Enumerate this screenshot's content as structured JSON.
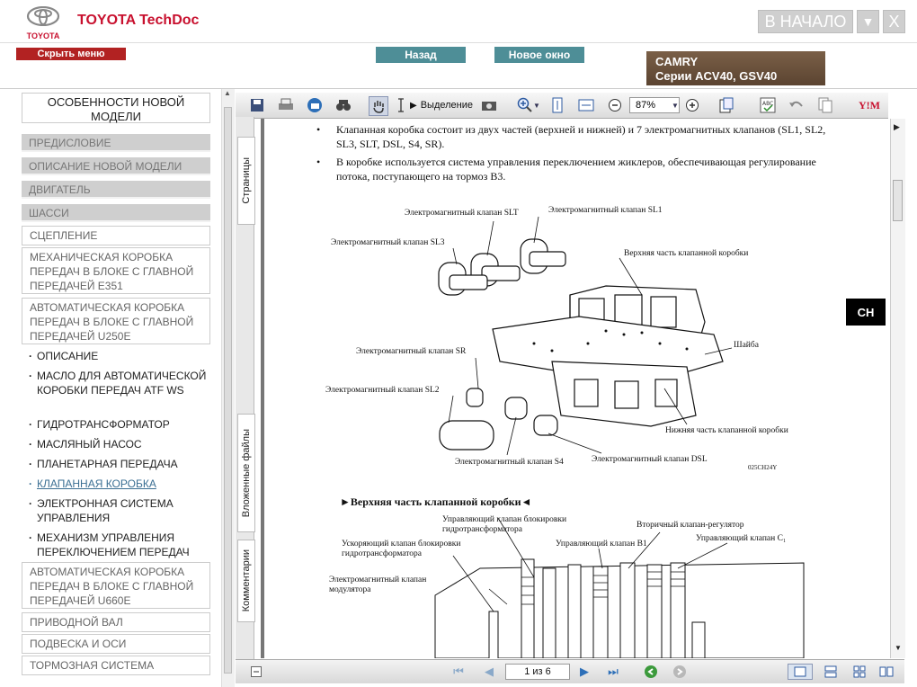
{
  "header": {
    "brand_title": "TOYOTA TechDoc",
    "logo_text": "TOYOTA",
    "home_button": "В НАЧАЛО",
    "menu_button": "▼",
    "close_button": "X"
  },
  "subbar": {
    "hide_menu": "Скрыть меню",
    "back": "Назад",
    "new_window": "Новое окно",
    "model_name": "CAMRY",
    "model_series": "Серии ACV40, GSV40"
  },
  "nav": {
    "title": "ОСОБЕННОСТИ НОВОЙ МОДЕЛИ",
    "gray_items": [
      "ПРЕДИСЛОВИЕ",
      "ОПИСАНИЕ НОВОЙ МОДЕЛИ",
      "ДВИГАТЕЛЬ",
      "ШАССИ"
    ],
    "clutch": "СЦЕПЛЕНИЕ",
    "manual_trans": "МЕХАНИЧЕСКАЯ КОРОБКА ПЕРЕДАЧ В БЛОКЕ С ГЛАВНОЙ ПЕРЕДАЧЕЙ E351",
    "auto_trans_u250e": "АВТОМАТИЧЕСКАЯ КОРОБКА ПЕРЕДАЧ В БЛОКЕ С ГЛАВНОЙ ПЕРЕДАЧЕЙ U250E",
    "sub_items": [
      "ОПИСАНИЕ",
      "МАСЛО ДЛЯ АВТОМАТИЧЕСКОЙ КОРОБКИ ПЕРЕДАЧ ATF WS",
      "ГИДРОТРАНСФОРМАТОР",
      "МАСЛЯНЫЙ НАСОС",
      "ПЛАНЕТАРНАЯ ПЕРЕДАЧА",
      "КЛАПАННАЯ КОРОБКА",
      "ЭЛЕКТРОННАЯ СИСТЕМА УПРАВЛЕНИЯ",
      "МЕХАНИЗМ УПРАВЛЕНИЯ ПЕРЕКЛЮЧЕНИЕМ ПЕРЕДАЧ"
    ],
    "auto_trans_u660e": "АВТОМАТИЧЕСКАЯ КОРОБКА ПЕРЕДАЧ В БЛОКЕ С ГЛАВНОЙ ПЕРЕДАЧЕЙ U660E",
    "drive_shaft": "ПРИВОДНОЙ ВАЛ",
    "suspension": "ПОДВЕСКА И ОСИ",
    "brakes": "ТОРМОЗНАЯ СИСТЕМА"
  },
  "sidetabs": {
    "pages": "Страницы",
    "attachments": "Вложенные файлы",
    "comments": "Комментарии"
  },
  "toolbar": {
    "select_label": "Выделение",
    "zoom": "87%"
  },
  "doc": {
    "bullet1": "Клапанная коробка состоит из двух частей (верхней и нижней) и 7 электромагнитных клапанов (SL1, SL2, SL3, SLT, DSL, S4, SR).",
    "bullet2": "В коробке используется система управления переключением жиклеров, обеспечивающая регулирование потока, поступающего на тормоз B3.",
    "labels": {
      "slt": "Электромагнитный клапан SLT",
      "sl1": "Электромагнитный клапан SL1",
      "sl3": "Электромагнитный клапан SL3",
      "upper_body": "Верхняя часть клапанной коробки",
      "washer": "Шайба",
      "sr": "Электромагнитный клапан SR",
      "sl2": "Электромагнитный клапан SL2",
      "lower_body": "Нижняя часть клапанной коробки",
      "s4": "Электромагнитный клапан S4",
      "dsl": "Электромагнитный клапан DSL",
      "figure_code": "025CH24Y"
    },
    "section_heading": "►Верхняя часть клапанной коробки◄",
    "labels2": {
      "lockup_control": "Управляющий клапан блокировки гидротрансформатора",
      "secondary_reg": "Вторичный клапан-регулятор",
      "lockup_accel": "Ускоряющий клапан блокировки гидротрансформатора",
      "b1_control": "Управляющий клапан B1",
      "c1_control": "Управляющий клапан C₁",
      "modulator": "Электромагнитный клапан модулятора"
    },
    "ch_tag": "CH"
  },
  "bottombar": {
    "page_indicator": "1 из 6"
  }
}
